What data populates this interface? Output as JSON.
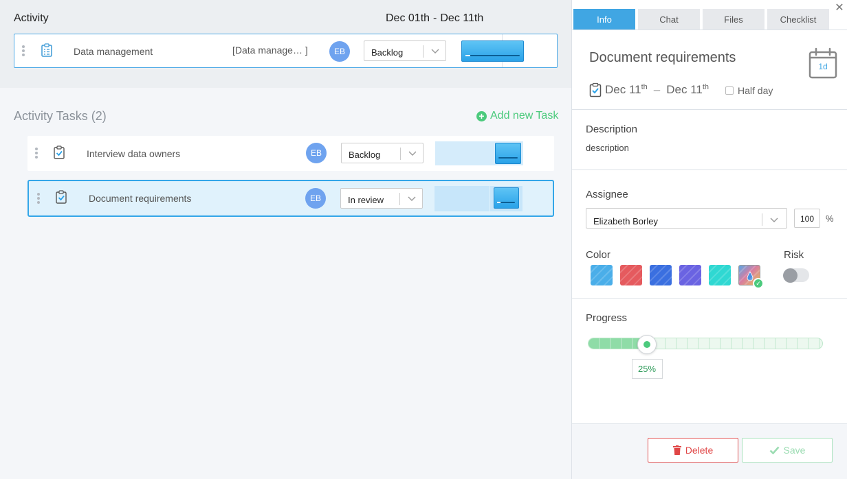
{
  "header": {
    "title": "Activity",
    "date_start": "Dec 01th",
    "date_end": "Dec 11th"
  },
  "activity_row": {
    "name": "Data management",
    "subtitle": "[Data manage…  ]",
    "assignee_initials": "EB",
    "status": "Backlog"
  },
  "tasks": {
    "title": "Activity Tasks (2)",
    "add_label": "Add new Task",
    "items": [
      {
        "name": "Interview data owners",
        "assignee_initials": "EB",
        "status": "Backlog"
      },
      {
        "name": "Document requirements",
        "assignee_initials": "EB",
        "status": "In review"
      }
    ]
  },
  "panel": {
    "tabs": [
      "Info",
      "Chat",
      "Files",
      "Checklist"
    ],
    "active_tab": "Info",
    "close_glyph": "✕",
    "task_title": "Document requirements",
    "duration_badge": "1d",
    "start_date": "Dec 11",
    "start_suffix": "th",
    "date_dash": "–",
    "end_date": "Dec 11",
    "end_suffix": "th",
    "half_day_label": "Half day",
    "description_label": "Description",
    "description_text": "description",
    "assignee_label": "Assignee",
    "assignee_value": "Elizabeth Borley",
    "allocation_value": "100",
    "percent_sign": "%",
    "color_label": "Color",
    "risk_label": "Risk",
    "risk_enabled": false,
    "colors": [
      "#4aaee9",
      "#e55a5e",
      "#3a6fe0",
      "#6a63e2",
      "#2fd8d2",
      "custom"
    ],
    "selected_color_index": 5,
    "progress_label": "Progress",
    "progress_value": 25,
    "progress_display": "25%",
    "delete_label": "Delete",
    "save_label": "Save"
  }
}
